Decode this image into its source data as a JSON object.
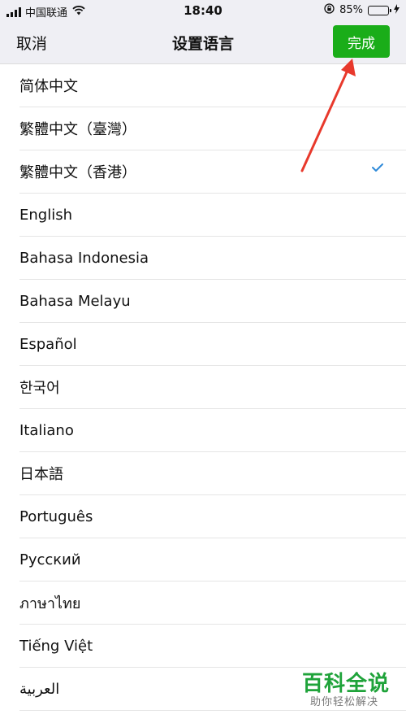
{
  "status_bar": {
    "carrier": "中国联通",
    "time": "18:40",
    "battery": "85%",
    "battery_level": 0.85
  },
  "nav": {
    "cancel_label": "取消",
    "title": "设置语言",
    "done_label": "完成"
  },
  "languages": [
    "简体中文",
    "繁體中文（臺灣）",
    "繁體中文（香港）",
    "English",
    "Bahasa Indonesia",
    "Bahasa Melayu",
    "Español",
    "한국어",
    "Italiano",
    "日本語",
    "Português",
    "Русский",
    "ภาษาไทย",
    "Tiếng Việt",
    "العربية"
  ],
  "selected_language": "繁體中文（香港）",
  "watermark": {
    "title": "百科全说",
    "subtitle": "助你轻松解决"
  },
  "colors": {
    "accent_green": "#1aad19",
    "check_blue": "#2f8ad9",
    "arrow_red": "#e8392c",
    "watermark_green": "#1fa33a",
    "nav_background": "#efeff4"
  }
}
